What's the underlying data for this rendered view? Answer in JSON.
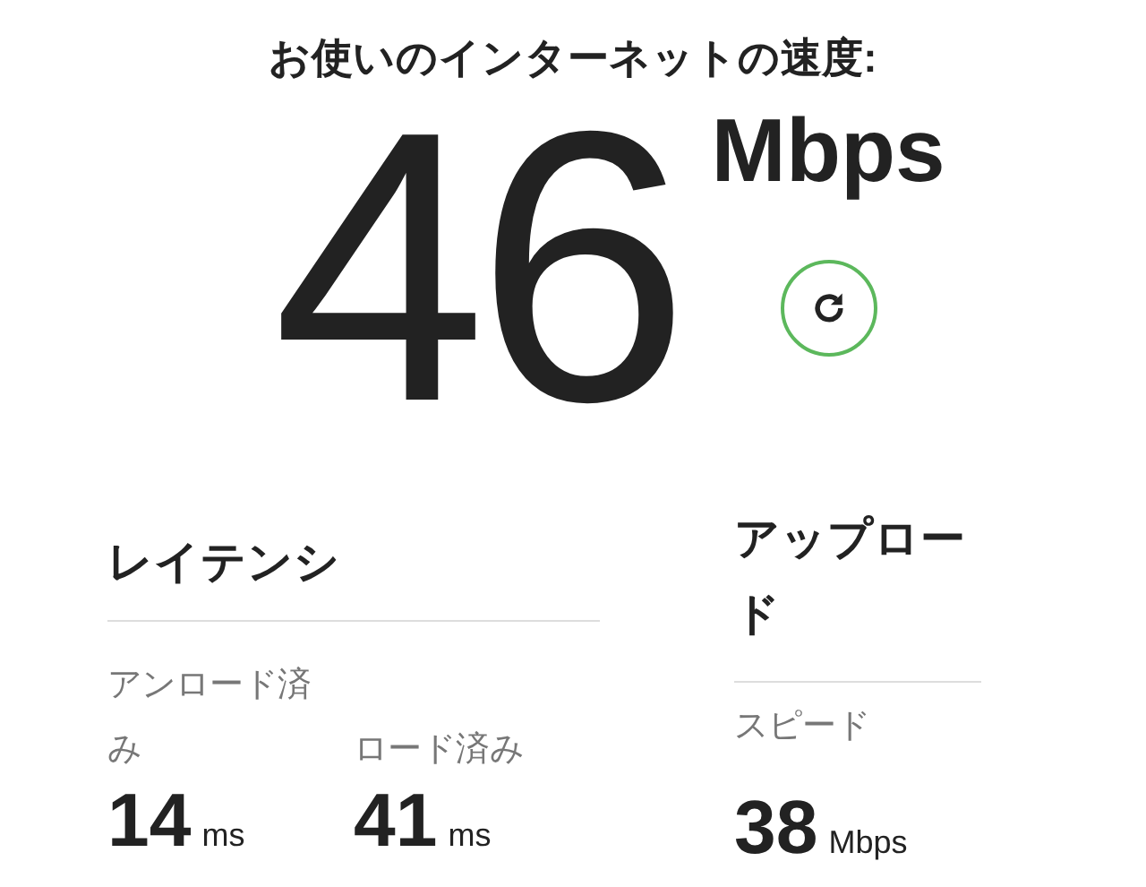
{
  "title": "お使いのインターネットの速度:",
  "speed": {
    "value": "46",
    "unit": "Mbps"
  },
  "latency": {
    "heading": "レイテンシ",
    "metrics": [
      {
        "label": "アンロード済み",
        "value": "14",
        "unit": "ms"
      },
      {
        "label": "ロード済み",
        "value": "41",
        "unit": "ms"
      }
    ]
  },
  "upload": {
    "heading": "アップロード",
    "label": "スピード",
    "value": "38",
    "unit": "Mbps"
  }
}
